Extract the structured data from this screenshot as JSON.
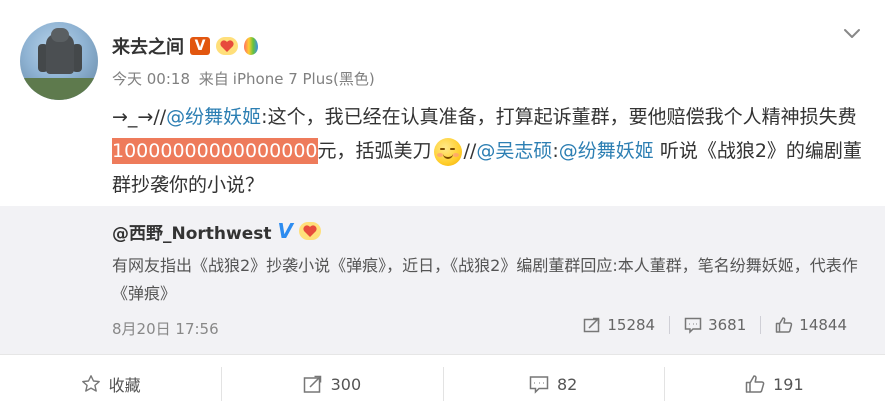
{
  "post": {
    "username": "来去之间",
    "badges": {
      "verified": "V",
      "fan_icon": "fan-badge-icon",
      "balloon_icon": "balloon-badge-icon"
    },
    "meta": {
      "time": "今天 00:18",
      "source_prefix": "来自",
      "source": "iPhone 7 Plus(黑色)"
    },
    "content": {
      "part1": "→_→//",
      "mention1": "@纷舞妖姬",
      "part2": ":这个，我已经在认真准备，打算起诉董群，要他赔偿我个人精神损失费",
      "highlight": "10000000000000000",
      "part3": "元，括弧美刀",
      "part4": "//",
      "mention2": "@吴志硕",
      "part5": ":",
      "mention3": "@纷舞妖姬",
      "part6": " 听说《战狼2》的编剧董群抄袭你的小说？"
    }
  },
  "repost": {
    "username": "@西野_Northwest",
    "verified": "V",
    "text": "有网友指出《战狼2》抄袭小说《弹痕》，近日，《战狼2》编剧董群回应:本人董群，笔名纷舞妖姬，代表作《弹痕》",
    "time": "8月20日 17:56",
    "stats": {
      "reposts": "15284",
      "comments": "3681",
      "likes": "14844"
    }
  },
  "actions": {
    "favorite": "收藏",
    "repost": "300",
    "comment": "82",
    "like": "191"
  },
  "colors": {
    "accent": "#2d7fb3",
    "highlight": "#ee7b5b",
    "repost_bg": "#f2f2f5"
  }
}
